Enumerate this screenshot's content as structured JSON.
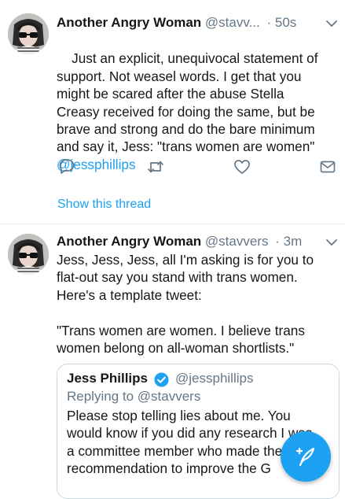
{
  "tweet1": {
    "author_name": "Another Angry Woman",
    "author_handle": "@stavv...",
    "separator": "·",
    "time": "50s",
    "text": "Just an explicit, unequivocal statement of\nsupport. Not weasel words. I get that you\nmight be scared after the abuse Stella\nCreasy received for doing the same, but be\nbrave and strong and do the bare minimum\nand say it, Jess: \"trans women are women\"",
    "mention": "@jessphillips",
    "show_thread": "Show this thread",
    "icons": [
      "reply-icon",
      "retweet-icon",
      "like-icon",
      "share-icon"
    ]
  },
  "tweet2": {
    "author_name": "Another Angry Woman",
    "author_handle": "@stavvers",
    "separator": "·",
    "time": "3m",
    "text": "Jess, Jess, Jess, all I'm asking is for you to\nflat-out say you stand with trans women.\nHere's a template tweet:\n\n\"Trans women are women. I believe trans\nwomen belong on all-woman shortlists.\"",
    "quote": {
      "name": "Jess Phillips",
      "handle": "@jessphillips",
      "replying_to": "Replying to @stavvers",
      "text": "Please stop telling lies about me. You\nwould know if you did any research I was\na committee member who made the\nrecommendation to improve the G"
    }
  },
  "fab": {
    "icon": "compose-tweet-icon"
  },
  "colors": {
    "accent": "#1da1f2",
    "secondary_text": "#657786",
    "border": "#e6ecf0"
  }
}
